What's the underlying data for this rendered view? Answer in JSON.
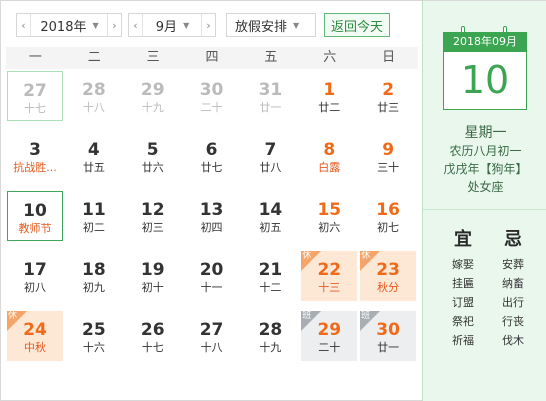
{
  "toolbar": {
    "year": "2018年",
    "month": "9月",
    "holiday": "放假安排",
    "today_label": "返回今天",
    "prev_icon": "chevron-left-icon",
    "next_icon": "chevron-right-icon",
    "caret_icon": "caret-down-icon"
  },
  "weekdays": [
    "一",
    "二",
    "三",
    "四",
    "五",
    "六",
    "日"
  ],
  "weeks": [
    [
      {
        "day": "27",
        "lunar": "十七",
        "other": true,
        "outline": true
      },
      {
        "day": "28",
        "lunar": "十八",
        "other": true
      },
      {
        "day": "29",
        "lunar": "十九",
        "other": true
      },
      {
        "day": "30",
        "lunar": "二十",
        "other": true
      },
      {
        "day": "31",
        "lunar": "廿一",
        "other": true
      },
      {
        "day": "1",
        "lunar": "廿二",
        "weekend": true
      },
      {
        "day": "2",
        "lunar": "廿三",
        "weekend": true
      }
    ],
    [
      {
        "day": "3",
        "lunar": "抗战胜...",
        "red": true
      },
      {
        "day": "4",
        "lunar": "廿五"
      },
      {
        "day": "5",
        "lunar": "廿六"
      },
      {
        "day": "6",
        "lunar": "廿七"
      },
      {
        "day": "7",
        "lunar": "廿八"
      },
      {
        "day": "8",
        "lunar": "白露",
        "weekend": true,
        "red": true
      },
      {
        "day": "9",
        "lunar": "三十",
        "weekend": true
      }
    ],
    [
      {
        "day": "10",
        "lunar": "教师节",
        "today": true
      },
      {
        "day": "11",
        "lunar": "初二"
      },
      {
        "day": "12",
        "lunar": "初三"
      },
      {
        "day": "13",
        "lunar": "初四"
      },
      {
        "day": "14",
        "lunar": "初五"
      },
      {
        "day": "15",
        "lunar": "初六",
        "weekend": true
      },
      {
        "day": "16",
        "lunar": "初七",
        "weekend": true
      }
    ],
    [
      {
        "day": "17",
        "lunar": "初八"
      },
      {
        "day": "18",
        "lunar": "初九"
      },
      {
        "day": "19",
        "lunar": "初十"
      },
      {
        "day": "20",
        "lunar": "十一"
      },
      {
        "day": "21",
        "lunar": "十二"
      },
      {
        "day": "22",
        "lunar": "十三",
        "weekend": true,
        "rest": true,
        "badge": "休"
      },
      {
        "day": "23",
        "lunar": "秋分",
        "weekend": true,
        "rest": true,
        "badge": "休"
      }
    ],
    [
      {
        "day": "24",
        "lunar": "中秋",
        "rest": true,
        "badge": "休",
        "weekend": true
      },
      {
        "day": "25",
        "lunar": "十六"
      },
      {
        "day": "26",
        "lunar": "十七"
      },
      {
        "day": "27",
        "lunar": "十八"
      },
      {
        "day": "28",
        "lunar": "十九"
      },
      {
        "day": "29",
        "lunar": "二十",
        "weekend": true,
        "work": true,
        "badge": "班"
      },
      {
        "day": "30",
        "lunar": "廿一",
        "weekend": true,
        "work": true,
        "badge": "班"
      }
    ]
  ],
  "panel": {
    "header": "2018年09月",
    "day": "10",
    "weekday": "星期一",
    "lunar": "农历八月初一",
    "ganzhi": "戊戌年【狗年】",
    "zodiac": "处女座",
    "yi_title": "宜",
    "ji_title": "忌",
    "yi": [
      "嫁娶",
      "挂匾",
      "订盟",
      "祭祀",
      "祈福"
    ],
    "ji": [
      "安葬",
      "纳畜",
      "出行",
      "行丧",
      "伐木"
    ]
  },
  "colors": {
    "accent_green": "#3ca552",
    "weekend_orange": "#f06a1a",
    "rest_bg": "#fde8d6",
    "work_bg": "#eceeef",
    "panel_bg": "#e9f7ec"
  }
}
